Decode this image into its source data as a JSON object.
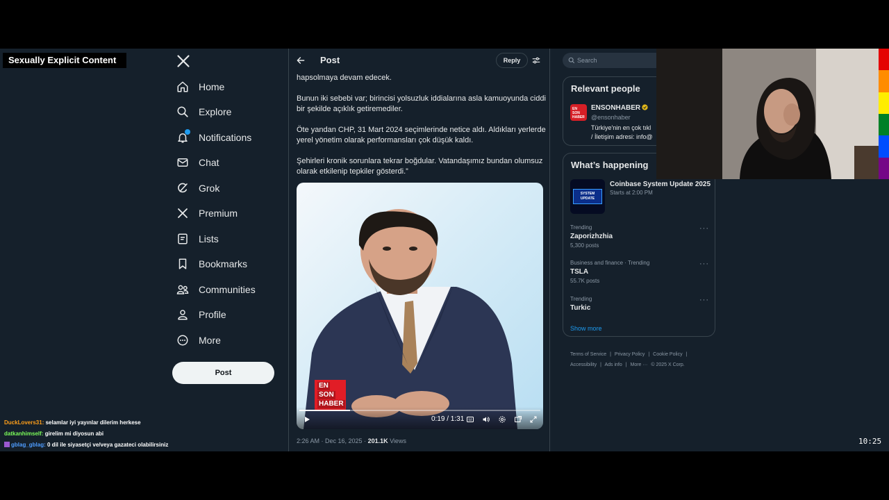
{
  "overlay": {
    "warning": "Sexually Explicit Content",
    "clock": "10:25"
  },
  "nav": {
    "items": [
      {
        "label": "Home",
        "icon": "home-icon"
      },
      {
        "label": "Explore",
        "icon": "search-icon"
      },
      {
        "label": "Notifications",
        "icon": "bell-icon"
      },
      {
        "label": "Chat",
        "icon": "mail-icon"
      },
      {
        "label": "Grok",
        "icon": "grok-icon"
      },
      {
        "label": "Premium",
        "icon": "x-logo-icon"
      },
      {
        "label": "Lists",
        "icon": "list-icon"
      },
      {
        "label": "Bookmarks",
        "icon": "bookmark-icon"
      },
      {
        "label": "Communities",
        "icon": "people-icon"
      },
      {
        "label": "Profile",
        "icon": "person-icon"
      },
      {
        "label": "More",
        "icon": "more-circle-icon"
      }
    ],
    "post_button": "Post"
  },
  "post": {
    "header_title": "Post",
    "reply_label": "Reply",
    "text": [
      "hapsolmaya devam edecek.",
      "Bunun iki sebebi var; birincisi yolsuzluk iddialarına asla kamuoyunda ciddi bir şekilde açıklık getiremediler.",
      "Öte yandan CHP, 31 Mart 2024 seçimlerinde netice aldı. Aldıkları yerlerde yerel yönetim olarak performansları çok düşük kaldı.",
      "Şehirleri kronik sorunlara tekrar boğdular. Vatandaşımız bundan olumsuz olarak etkilenip tepkiler gösterdi.”"
    ],
    "video": {
      "time": "0:19 / 1:31",
      "progress": 0.209,
      "logo_lines": [
        "EN",
        "SON",
        "HABER"
      ]
    },
    "timestamp": "2:26 AM · Dec 16, 2025 · ",
    "views_count": "201.1K",
    "views_label": " Views"
  },
  "sidebar": {
    "search_placeholder": "Search",
    "relevant_title": "Relevant people",
    "person": {
      "name": "ENSONHABER",
      "handle": "@ensonhaber",
      "bio_lines": [
        "Türkiye'nin en çok tıkl",
        "/ İletişim adresi: info@"
      ],
      "avatar_lines": [
        "EN",
        "SON",
        "HABER"
      ]
    },
    "happening_title": "What’s happening",
    "event": {
      "title": "Coinbase System Update 2025",
      "sub": "Starts at 2:00 PM",
      "thumb_text": "SYSTEM UPDATE"
    },
    "trends": [
      {
        "context": "Trending",
        "name": "Zaporizhzhia",
        "count": "5,300 posts"
      },
      {
        "context": "Business and finance · Trending",
        "name": "TSLA",
        "count": "55.7K posts"
      },
      {
        "context": "Trending",
        "name": "Turkic",
        "count": ""
      }
    ],
    "show_more": "Show more",
    "footer": [
      "Terms of Service",
      "|",
      "Privacy Policy",
      "|",
      "Cookie Policy",
      "|",
      "Accessibility",
      "|",
      "Ads info",
      "|",
      "More ···",
      "© 2025 X Corp."
    ]
  },
  "chat": [
    {
      "user": "DuckLovers31:",
      "msg": " selamlar iyi yayınlar dilerim herkese"
    },
    {
      "user": "datkanhimself:",
      "msg": " girelim mi diyosun abi"
    },
    {
      "user": "gblag_gblag:",
      "msg": " 0 dil ile siyasetçi ve/veya gazateci olabilirsiniz"
    }
  ],
  "colors": {
    "bg": "#15202b",
    "accent": "#1d9bf0",
    "border": "#38444d",
    "muted": "#8b98a5",
    "logo_red": "#e11d26"
  }
}
